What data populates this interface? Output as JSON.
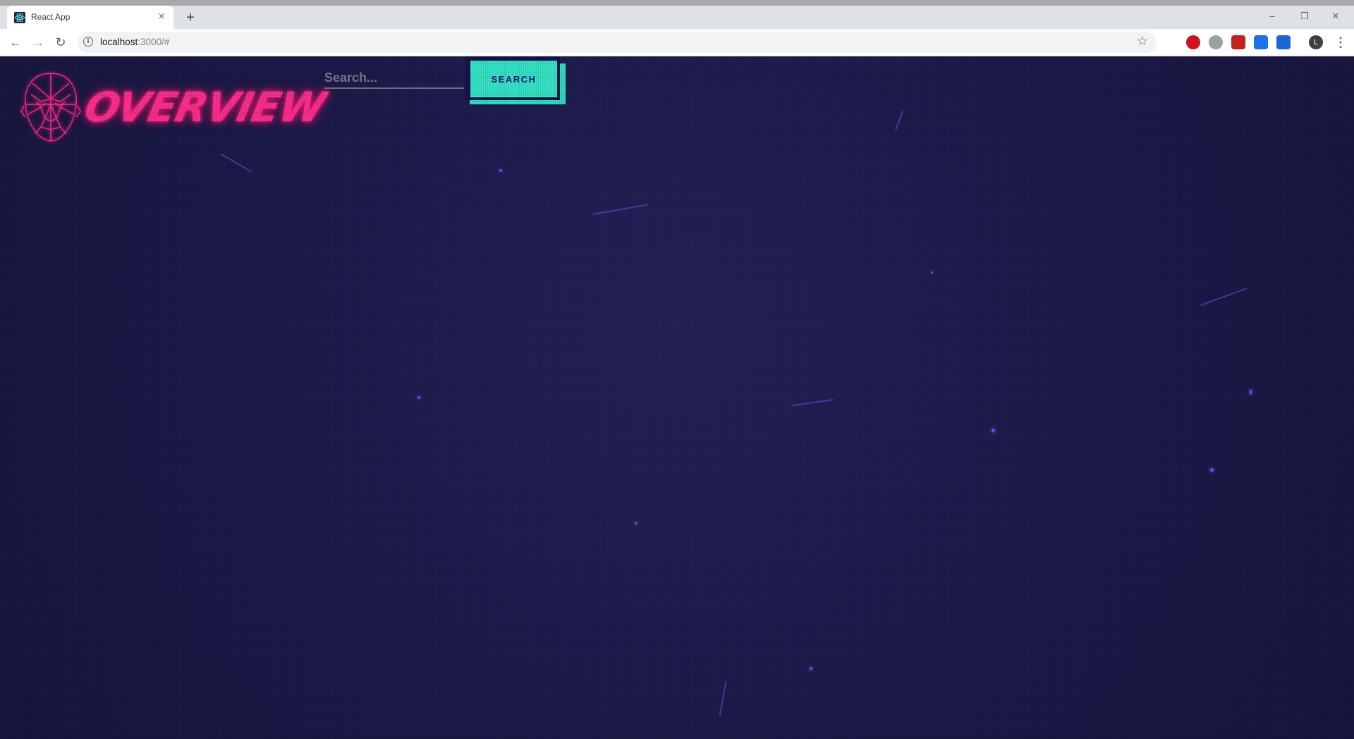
{
  "browser": {
    "tab_title": "React App",
    "tab_close": "×",
    "new_tab": "+",
    "window_controls": {
      "minimize": "–",
      "restore": "❐",
      "close": "✕"
    },
    "nav": {
      "back": "←",
      "forward": "→",
      "reload": "↻"
    },
    "url_host": "localhost",
    "url_rest": ":3000/#",
    "info_glyph": "i",
    "star_glyph": "☆",
    "avatar_letter": "L",
    "menu_glyph": "⋮",
    "extensions": [
      {
        "name": "opera-ext-icon",
        "color": "#d1121b"
      },
      {
        "name": "help-ext-icon",
        "color": "#9aa0a6"
      },
      {
        "name": "red-ext-icon",
        "color": "#c5221f"
      },
      {
        "name": "blue-ext-icon",
        "color": "#1a73e8"
      },
      {
        "name": "screen-ext-icon",
        "color": "#1967d2"
      }
    ]
  },
  "app": {
    "logo_text": "OVERVIEW",
    "search": {
      "placeholder": "Search...",
      "button_label": "SEARCH"
    },
    "colors": {
      "background": "#1d1b4a",
      "logo_pink": "#ff2f8e",
      "button_teal": "#35e6c9",
      "button_text": "#1d1b7a"
    }
  }
}
